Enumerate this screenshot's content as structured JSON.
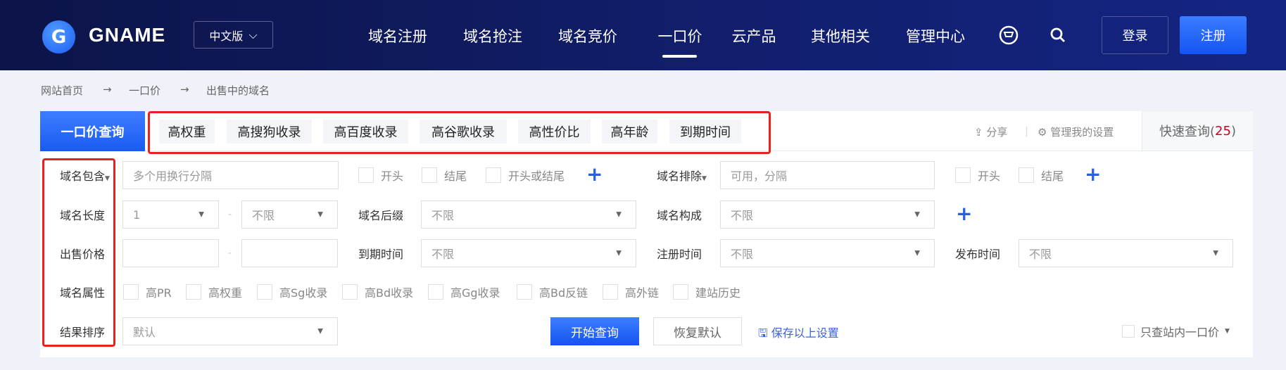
{
  "header": {
    "brand": "GNAME",
    "logo_letter": "G",
    "lang": "中文版",
    "nav": [
      "域名注册",
      "域名抢注",
      "域名竞价",
      "一口价",
      "云产品",
      "其他相关",
      "管理中心"
    ],
    "active_nav": "一口价",
    "login": "登录",
    "register": "注册"
  },
  "breadcrumb": [
    "网站首页",
    "一口价",
    "出售中的域名"
  ],
  "tabs": {
    "main": "一口价查询",
    "chips": [
      "高权重",
      "高搜狗收录",
      "高百度收录",
      "高谷歌收录",
      "高性价比",
      "高年龄",
      "到期时间"
    ],
    "share": "分享",
    "manage": "管理我的设置",
    "quick_label": "快速查询(",
    "quick_count": "25",
    "quick_close": ")"
  },
  "form": {
    "labels": {
      "contain": "域名包含",
      "length": "域名长度",
      "price": "出售价格",
      "attr": "域名属性",
      "sort": "结果排序",
      "exclude": "域名排除",
      "suffix": "域名后缀",
      "compose": "域名构成",
      "expire": "到期时间",
      "regtime": "注册时间",
      "pubtime": "发布时间"
    },
    "contain_placeholder": "多个用换行分隔",
    "exclude_placeholder": "可用，分隔",
    "contain_opts": [
      "开头",
      "结尾",
      "开头或结尾"
    ],
    "exclude_opts": [
      "开头",
      "结尾"
    ],
    "length_min": "1",
    "length_max": "不限",
    "suffix": "不限",
    "compose": "不限",
    "expire": "不限",
    "regtime": "不限",
    "pubtime": "不限",
    "attrs": [
      "高PR",
      "高权重",
      "高Sg收录",
      "高Bd收录",
      "高Gg收录",
      "高Bd反链",
      "高外链",
      "建站历史"
    ],
    "sort": "默认",
    "search_btn": "开始查询",
    "reset_btn": "恢复默认",
    "save": "保存以上设置",
    "only_internal": "只查站内一口价"
  }
}
